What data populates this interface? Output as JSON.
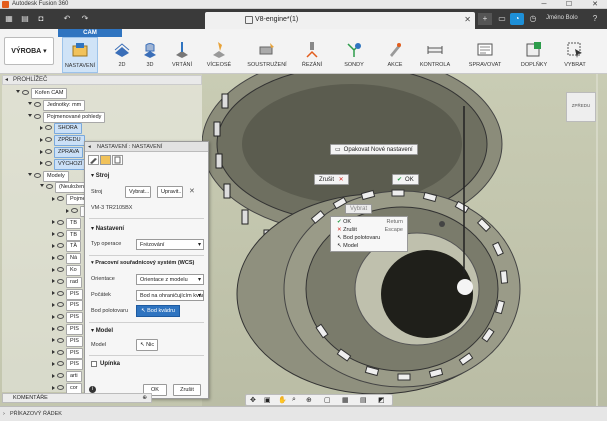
{
  "window": {
    "title": "Autodesk Fusion 360",
    "minimize": "─",
    "maximize": "☐",
    "close": "✕"
  },
  "tabbar": {
    "doc_title": "V8-engine*(1)",
    "user": "Jméno Bolo",
    "help": "?",
    "notif_count": "7"
  },
  "ribbon": {
    "workspace": "VÝROBA",
    "cam_tab": "CAM",
    "groups": [
      "NASTAVENÍ",
      "2D",
      "3D",
      "VRTÁNÍ",
      "VÍCEOSÉ",
      "SOUSTRUŽENÍ",
      "ŘEZÁNÍ",
      "SONDY",
      "AKCE",
      "KONTROLA",
      "SPRAVOVAT",
      "DOPLŇKY",
      "VYBRAT"
    ]
  },
  "browser": {
    "title": "PROHLÍŽEČ",
    "nodes": [
      {
        "label": "Kořen CAM",
        "level": 0
      },
      {
        "label": "Jednotky: mm",
        "level": 1
      },
      {
        "label": "Pojmenované pohledy",
        "level": 1
      },
      {
        "label": "SHORA",
        "level": 2
      },
      {
        "label": "ZPŘEDU",
        "level": 2
      },
      {
        "label": "ZPRAVA",
        "level": 2
      },
      {
        "label": "VÝCHOZÍ",
        "level": 2
      },
      {
        "label": "Modely",
        "level": 1
      },
      {
        "label": "(Neuloženo)",
        "level": 2
      },
      {
        "label": "Pojmenované",
        "level": 3
      },
      {
        "label": "Pol",
        "level": 4
      },
      {
        "label": "TB",
        "level": 3
      },
      {
        "label": "TB",
        "level": 3
      },
      {
        "label": "TÄ",
        "level": 3
      },
      {
        "label": "Ná",
        "level": 3
      },
      {
        "label": "Ko",
        "level": 3
      },
      {
        "label": "rad",
        "level": 3
      },
      {
        "label": "PIS",
        "level": 3
      },
      {
        "label": "PIS",
        "level": 3
      },
      {
        "label": "PIS",
        "level": 3
      },
      {
        "label": "PIS",
        "level": 3
      },
      {
        "label": "PIS",
        "level": 3
      },
      {
        "label": "PIS",
        "level": 3
      },
      {
        "label": "PIS",
        "level": 3
      },
      {
        "label": "arti",
        "level": 3
      },
      {
        "label": "cor",
        "level": 3
      }
    ]
  },
  "viewport": {
    "viewcube_label": "ZPŘEDU",
    "repeat_label": "Opakovat Nové nastavení",
    "cancel_label": "Zrušit",
    "ok_label": "OK",
    "select_hint": "Vybrat",
    "context_menu": [
      {
        "label": "OK",
        "key": "Return"
      },
      {
        "label": "Zrušit",
        "key": "Escape"
      },
      {
        "label": "Bod polotovaru",
        "key": ""
      },
      {
        "label": "Model",
        "key": ""
      }
    ]
  },
  "dialog": {
    "title": "NASTAVENÍ : NASTAVENÍ",
    "stroj_section": "Stroj",
    "stroj_label": "Stroj",
    "select_btn": "Vybrat...",
    "edit_btn": "Upravit...",
    "machine_name": "VM-3 TR2105BX",
    "nastaveni_section": "Nastavení",
    "operation_type_label": "Typ operace",
    "operation_type_value": "Frézování",
    "wcs_section": "Pracovní souřadnicový systém (WCS)",
    "orientation_label": "Orientace",
    "orientation_value": "Orientace z modelu",
    "origin_label": "Počátek",
    "origin_value": "Bod na ohraničujícím kvádru polotovaru",
    "stock_point_label": "Bod polotovaru",
    "stock_point_value": "Bod kvádru",
    "model_section": "Model",
    "model_label": "Model",
    "model_value": "Nic",
    "fixture_label": "Upínka",
    "ok": "OK",
    "cancel": "Zrušit",
    "info": "i"
  },
  "bottom": {
    "comments": "KOMENTÁŘE",
    "status": "PŘÍKAZOVÝ ŘÁDEK"
  },
  "colors": {
    "accent": "#2f74c0",
    "tabbar": "#3a3a3a",
    "viewport": "#c4c7af"
  }
}
